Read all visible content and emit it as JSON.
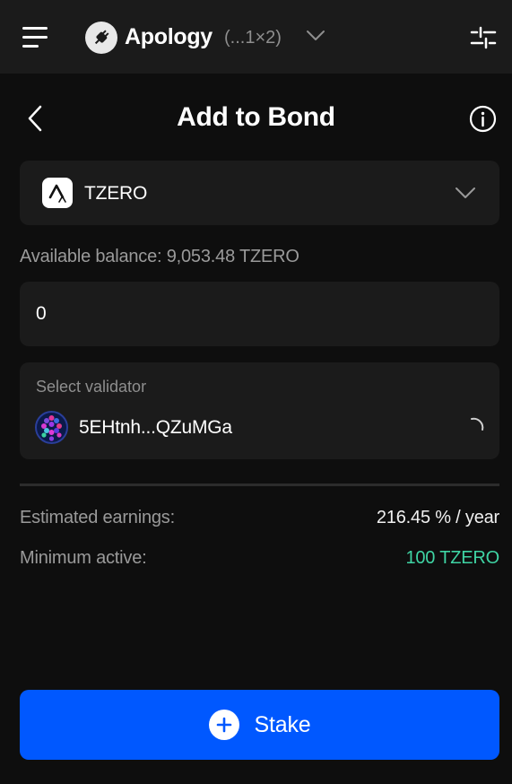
{
  "header": {
    "account_name": "Apology",
    "account_address": "(...1×2)",
    "icons": {
      "menu": "hamburger-menu-icon",
      "avatar": "plug-icon",
      "chevron": "chevron-down-icon",
      "settings": "sliders-icon"
    }
  },
  "page": {
    "title": "Add to Bond",
    "back_icon": "chevron-left-icon",
    "info_icon": "info-icon"
  },
  "token": {
    "name": "TZERO",
    "icon": "tzero-logo-icon"
  },
  "balance": {
    "label": "Available balance:",
    "value": "9,053.48 TZERO"
  },
  "amount": {
    "value": "0"
  },
  "validator": {
    "label": "Select validator",
    "address": "5EHtnh...QZuMGa",
    "icon": "polkadot-identicon",
    "status_icon": "loading-spinner-icon"
  },
  "stats": {
    "earnings_label": "Estimated earnings:",
    "earnings_value": "216.45 % / year",
    "min_active_label": "Minimum active:",
    "min_active_value": "100 TZERO"
  },
  "colors": {
    "accent": "#0058ff",
    "positive": "#3fd4a4",
    "card": "#1b1b1b",
    "background": "#0e0e0e"
  },
  "action": {
    "stake_label": "Stake",
    "icon": "plus-circle-icon"
  }
}
